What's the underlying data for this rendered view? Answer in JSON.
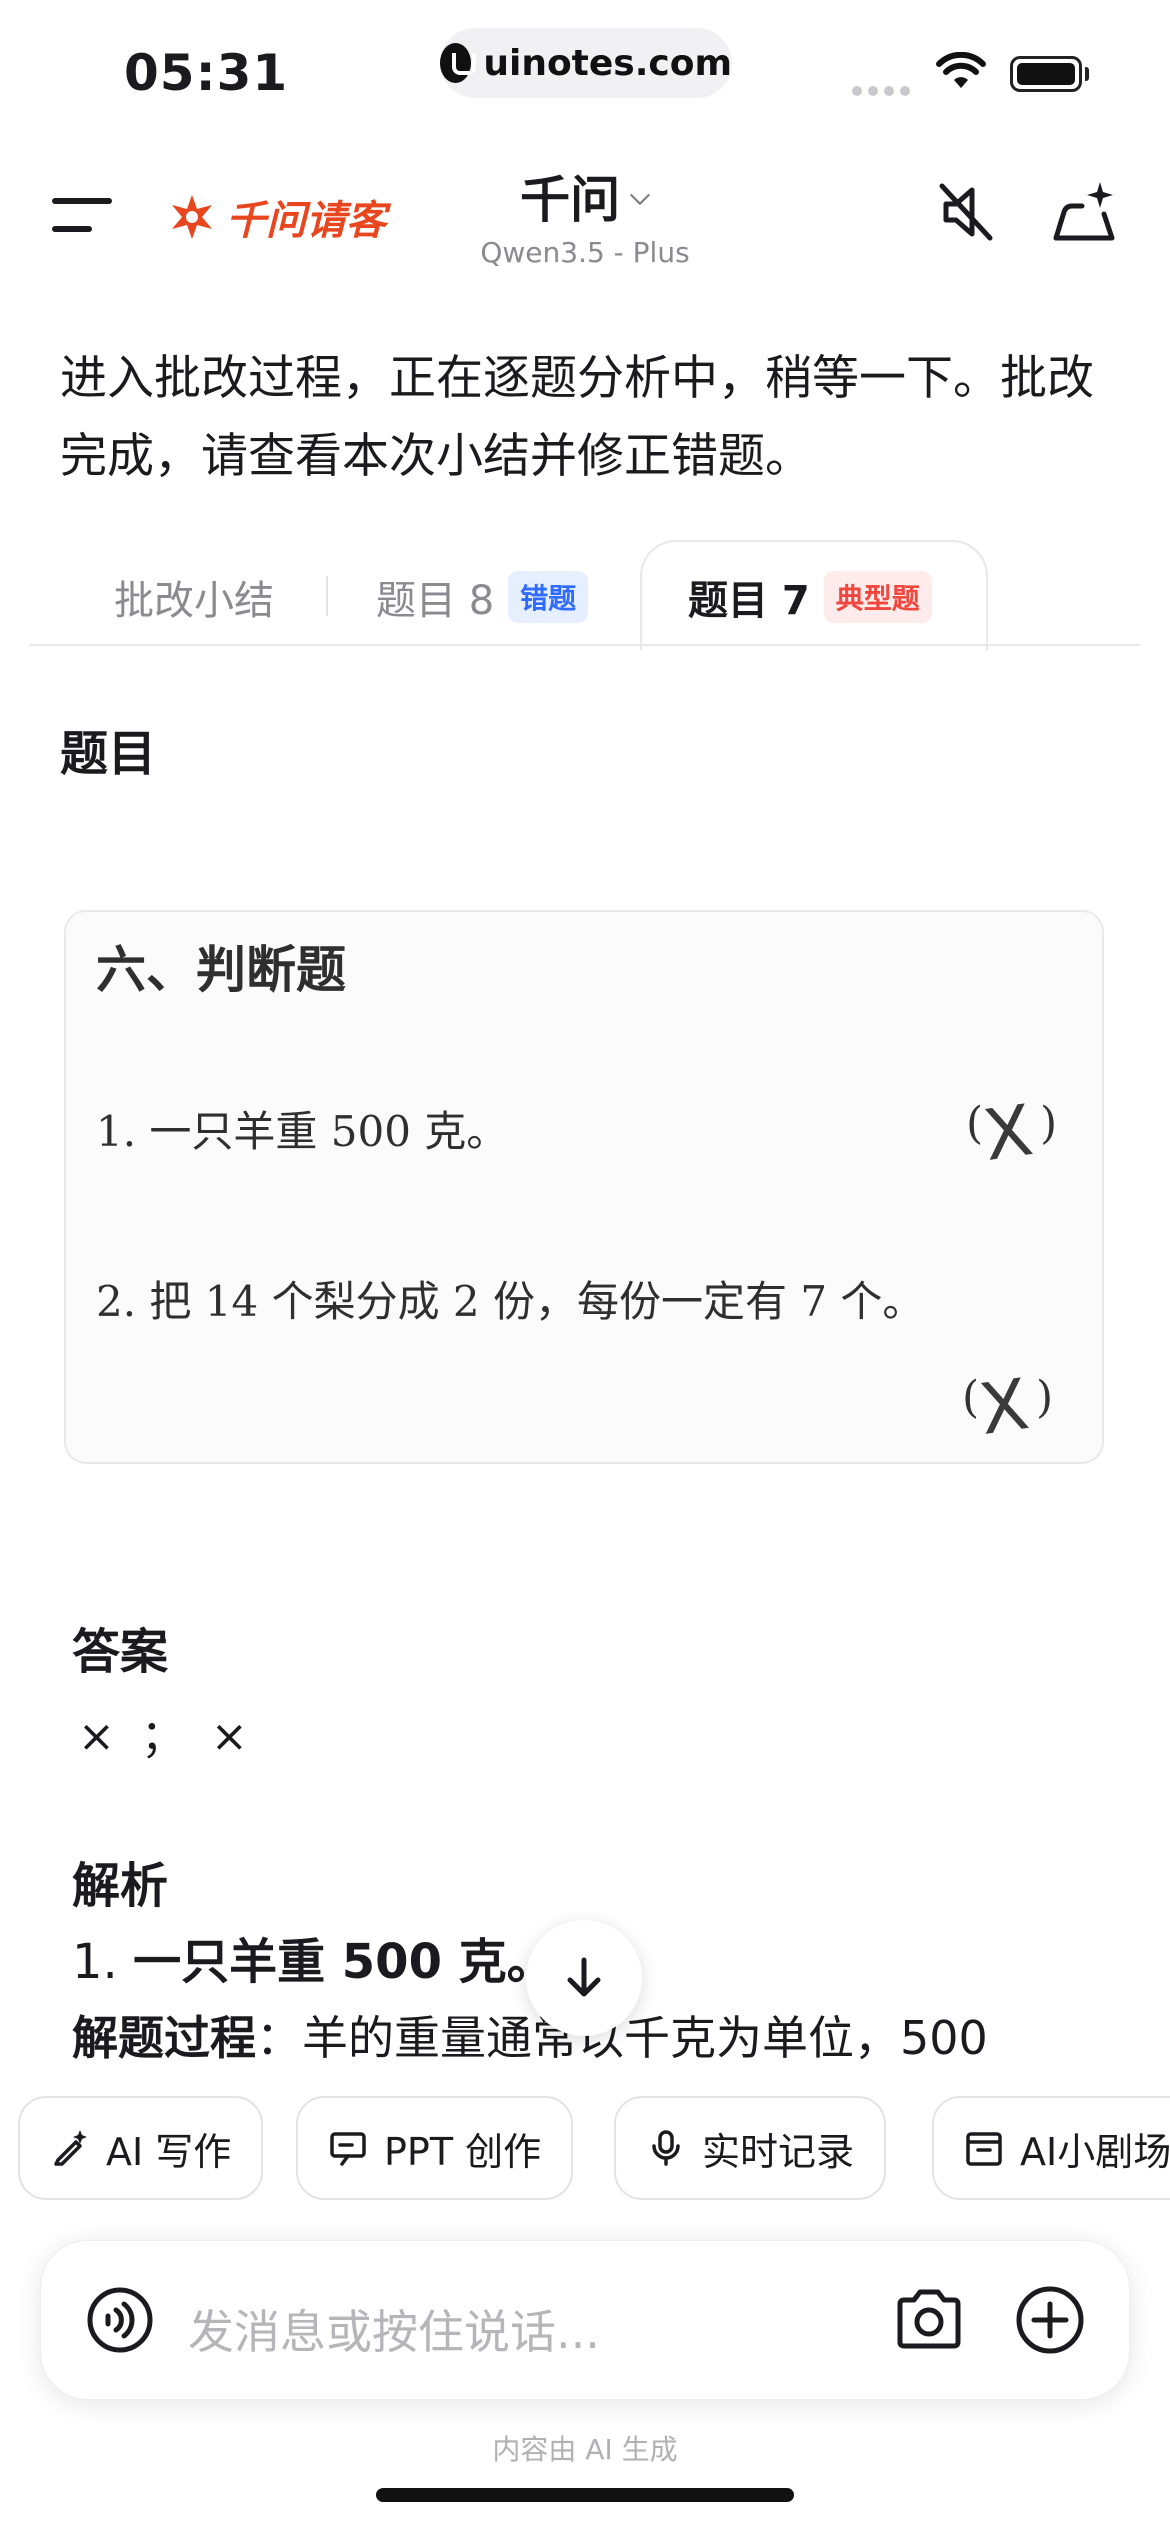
{
  "status_bar": {
    "time": "05:31",
    "url": "uinotes.com"
  },
  "header": {
    "brand": "千问请客",
    "title": "千问",
    "subtitle": "Qwen3.5 - Plus"
  },
  "message": {
    "text": "进入批改过程，正在逐题分析中，稍等一下。批改完成，请查看本次小结并修正错题。"
  },
  "tabs": [
    {
      "label": "批改小结",
      "badge": ""
    },
    {
      "label": "题目 8",
      "badge": "错题"
    },
    {
      "label": "题目 7",
      "badge": "典型题"
    }
  ],
  "question": {
    "heading": "题目",
    "image": {
      "section": "六、判断题",
      "item1": "1.  一只羊重 500 克。",
      "item2": "2.  把 14 个梨分成 2 份，每份一定有 7 个。",
      "mark_open": "(",
      "mark_close": ")",
      "mark_x": "X"
    }
  },
  "answer": {
    "heading": "答案",
    "text": "× ； ×"
  },
  "analysis": {
    "heading": "解析",
    "line1_prefix": "1. ",
    "line1_bold": "一只羊重 500 克。",
    "line2_bold": "解题过程",
    "line2_text": "：羊的重量通常以千克为单位，500"
  },
  "chips": [
    {
      "label": "AI 写作",
      "icon": "pen-sparkle-icon"
    },
    {
      "label": "PPT 创作",
      "icon": "presentation-icon"
    },
    {
      "label": "实时记录",
      "icon": "microphone-icon"
    },
    {
      "label": "AI小剧场",
      "icon": "theater-icon"
    }
  ],
  "input": {
    "placeholder": "发消息或按住说话..."
  },
  "footer": {
    "note": "内容由 AI 生成"
  },
  "colors": {
    "brand": "#e8461e",
    "badge_blue": "#2f6bff",
    "badge_red": "#f0473e"
  }
}
